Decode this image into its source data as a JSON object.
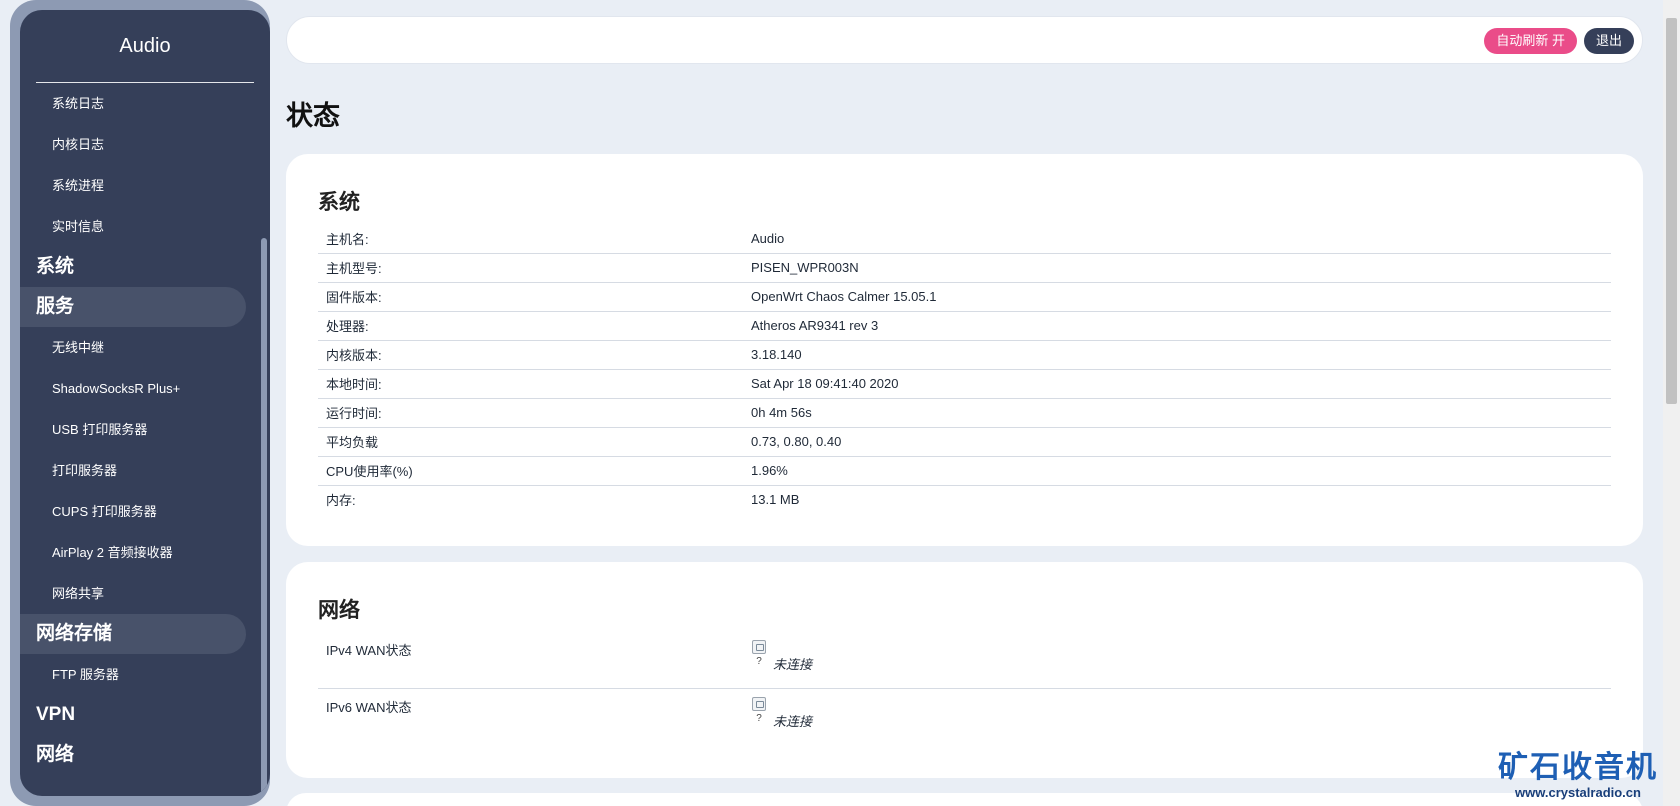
{
  "sidebar": {
    "title": "Audio",
    "status_sub": [
      "系统日志",
      "内核日志",
      "系统进程",
      "实时信息"
    ],
    "system_label": "系统",
    "services_label": "服务",
    "services_sub": [
      "无线中继",
      "ShadowSocksR Plus+",
      "USB 打印服务器",
      "打印服务器",
      "CUPS 打印服务器",
      "AirPlay 2 音频接收器",
      "网络共享"
    ],
    "nas_label": "网络存储",
    "nas_sub": [
      "FTP 服务器"
    ],
    "vpn_label": "VPN",
    "network_label": "网络"
  },
  "topbar": {
    "refresh_label": "自动刷新 开",
    "logout_label": "退出"
  },
  "page_title": "状态",
  "system_card": {
    "title": "系统",
    "rows": [
      {
        "key": "主机名:",
        "value": "Audio"
      },
      {
        "key": "主机型号:",
        "value": "PISEN_WPR003N"
      },
      {
        "key": "固件版本:",
        "value": "OpenWrt Chaos Calmer 15.05.1"
      },
      {
        "key": "处理器:",
        "value": "Atheros AR9341 rev 3"
      },
      {
        "key": "内核版本:",
        "value": "3.18.140"
      },
      {
        "key": "本地时间:",
        "value": "Sat Apr 18 09:41:40 2020"
      },
      {
        "key": "运行时间:",
        "value": "0h 4m 56s"
      },
      {
        "key": "平均负载",
        "value": "0.73, 0.80, 0.40"
      },
      {
        "key": "CPU使用率(%)",
        "value": "1.96%"
      },
      {
        "key": "内存:",
        "value": "13.1 MB"
      }
    ]
  },
  "network_card": {
    "title": "网络",
    "rows": [
      {
        "label": "IPv4 WAN状态",
        "icon_text": "?",
        "status": "未连接"
      },
      {
        "label": "IPv6 WAN状态",
        "icon_text": "?",
        "status": "未连接"
      }
    ]
  },
  "watermark": {
    "main": "矿石收音机",
    "sub": "www.crystalradio.cn"
  },
  "colors": {
    "sidebar_bg": "#353f59",
    "refresh_button": "#ea4c89",
    "logout_button": "#353f59",
    "page_bg": "#e9eef5"
  }
}
